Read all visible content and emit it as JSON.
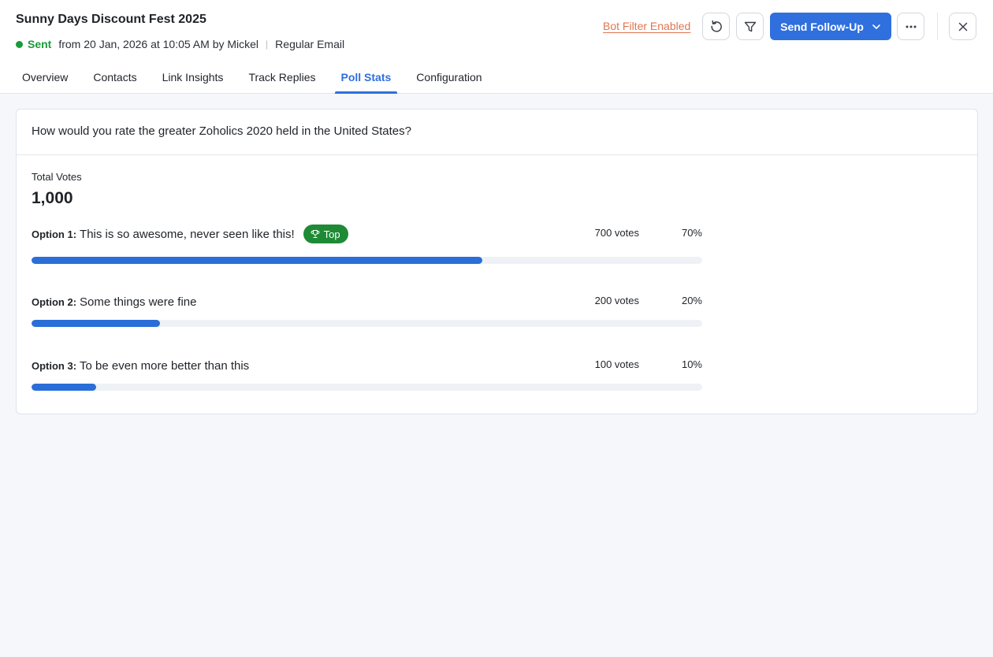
{
  "header": {
    "title": "Sunny Days Discount Fest 2025",
    "status": "Sent",
    "sent_info": "from 20 Jan, 2026 at 10:05 AM by Mickel",
    "email_type": "Regular Email",
    "bot_filter": "Bot Filter Enabled",
    "follow_up_label": "Send Follow-Up",
    "icons": {
      "refresh": "refresh-icon",
      "filter": "filter-icon",
      "more": "more-icon",
      "close": "close-icon",
      "chevron": "chevron-down-icon"
    }
  },
  "tabs": [
    {
      "label": "Overview",
      "active": false
    },
    {
      "label": "Contacts",
      "active": false
    },
    {
      "label": "Link Insights",
      "active": false
    },
    {
      "label": "Track Replies",
      "active": false
    },
    {
      "label": "Poll Stats",
      "active": true
    },
    {
      "label": "Configuration",
      "active": false
    }
  ],
  "poll": {
    "question": "How would you rate the greater Zoholics 2020 held in the United States?",
    "total_votes_label": "Total Votes",
    "total_votes": "1,000",
    "top_label": "Top",
    "options": [
      {
        "num": "Option 1:",
        "text": "This is so awesome, never seen like this!",
        "votes": "700 votes",
        "percent": "70%",
        "fraction": 0.7,
        "top": true
      },
      {
        "num": "Option 2:",
        "text": "Some things were fine",
        "votes": "200 votes",
        "percent": "20%",
        "fraction": 0.2,
        "top": false
      },
      {
        "num": "Option 3:",
        "text": "To be even more better than this",
        "votes": "100 votes",
        "percent": "10%",
        "fraction": 0.1,
        "top": false
      }
    ]
  },
  "colors": {
    "accent": "#2f6fde",
    "sent": "#1a9a3a",
    "bot_filter": "#e0754f",
    "top_badge": "#1f8a35",
    "bar_fill": "#2a6ed8",
    "bar_track": "#eef1f6"
  }
}
